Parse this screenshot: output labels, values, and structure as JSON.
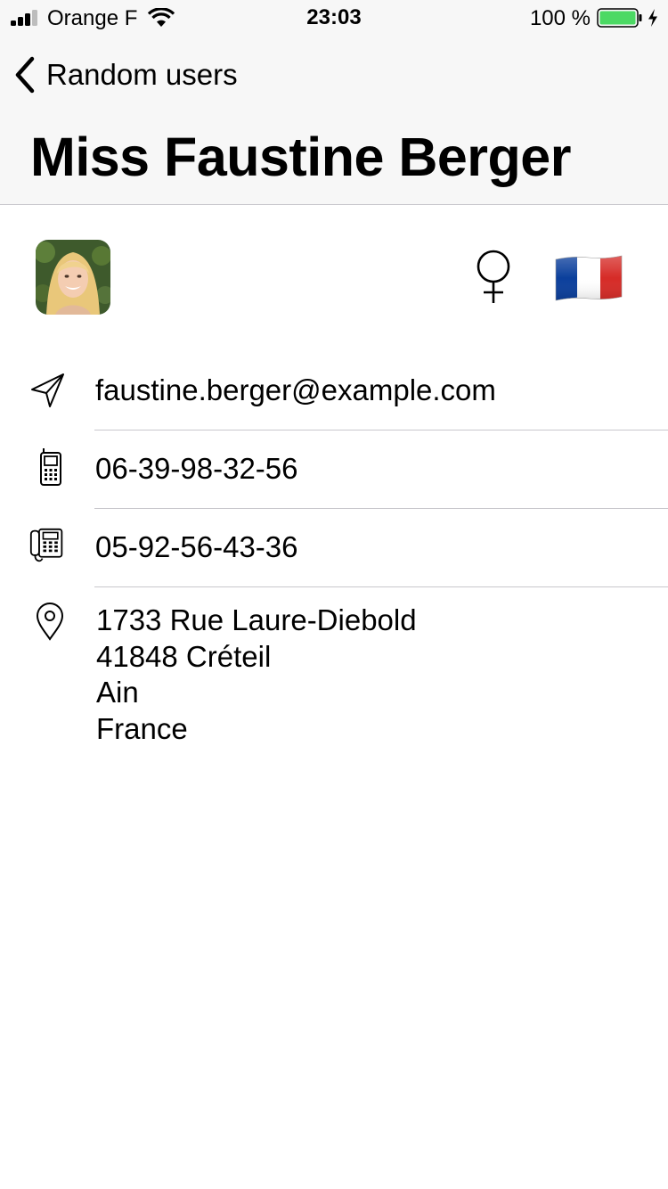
{
  "status_bar": {
    "carrier": "Orange F",
    "time": "23:03",
    "battery_percent": "100 %",
    "battery_level": 1.0,
    "battery_color": "#4cd964",
    "signal_bars_filled": 3,
    "signal_bars_total": 4
  },
  "nav": {
    "back_label": "Random users",
    "title": "Miss Faustine Berger"
  },
  "profile": {
    "gender_icon": "female-symbol-icon",
    "flag_icon": "france-flag-icon",
    "email": "faustine.berger@example.com",
    "cell": "06-39-98-32-56",
    "phone": "05-92-56-43-36",
    "address": {
      "street": "1733 Rue Laure-Diebold",
      "postcode_city": "41848 Créteil",
      "state": "Ain",
      "country": "France"
    }
  },
  "icons": {
    "email": "paper-plane-icon",
    "cell": "mobile-phone-icon",
    "phone": "desk-phone-icon",
    "address": "location-pin-icon"
  },
  "colors": {
    "nav_background": "#f7f7f7",
    "separator": "#c8c7cc",
    "text": "#000000",
    "flag_blue": "#0b3f9c",
    "flag_red": "#d62b27"
  }
}
